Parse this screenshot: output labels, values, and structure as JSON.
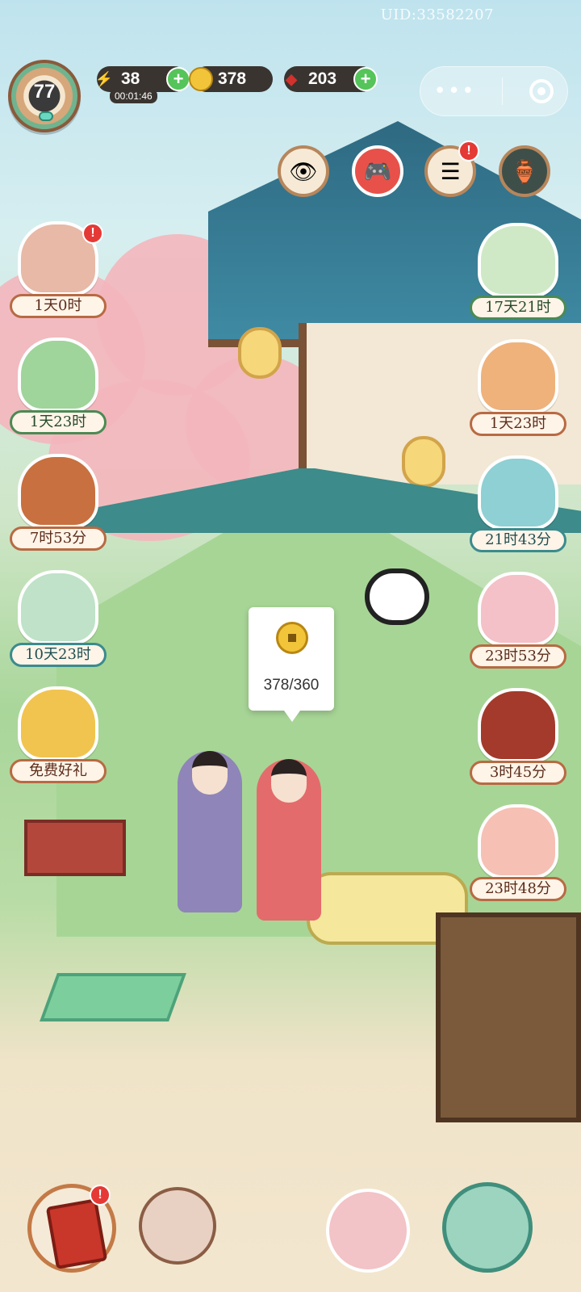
{
  "uid_text": "UID:33582207",
  "player": {
    "level": "77"
  },
  "resources": {
    "energy": {
      "value": "38",
      "timer": "00:01:46"
    },
    "coins": {
      "value": "378"
    },
    "gems": {
      "value": "203"
    }
  },
  "top_icons": [
    {
      "name": "view-icon"
    },
    {
      "name": "game-controller-icon",
      "badge": ""
    },
    {
      "name": "task-list-icon",
      "badge": "!"
    },
    {
      "name": "treasure-icon"
    }
  ],
  "left_events": [
    {
      "label": "1天0时",
      "badge": "!"
    },
    {
      "label": "1天23时"
    },
    {
      "label": "7时53分"
    },
    {
      "label": "10天23时"
    },
    {
      "label": "免费好礼"
    }
  ],
  "right_events": [
    {
      "label": "17天21时"
    },
    {
      "label": "1天23时"
    },
    {
      "label": "21时43分"
    },
    {
      "label": "23时53分"
    },
    {
      "label": "3时45分"
    },
    {
      "label": "23时48分"
    }
  ],
  "coin_bubble": {
    "count": "378/360"
  },
  "bottom": {
    "book_badge": "!"
  },
  "colors": {
    "badge": "#e53935",
    "plus": "#55c45a",
    "pill": "#3a3430"
  }
}
